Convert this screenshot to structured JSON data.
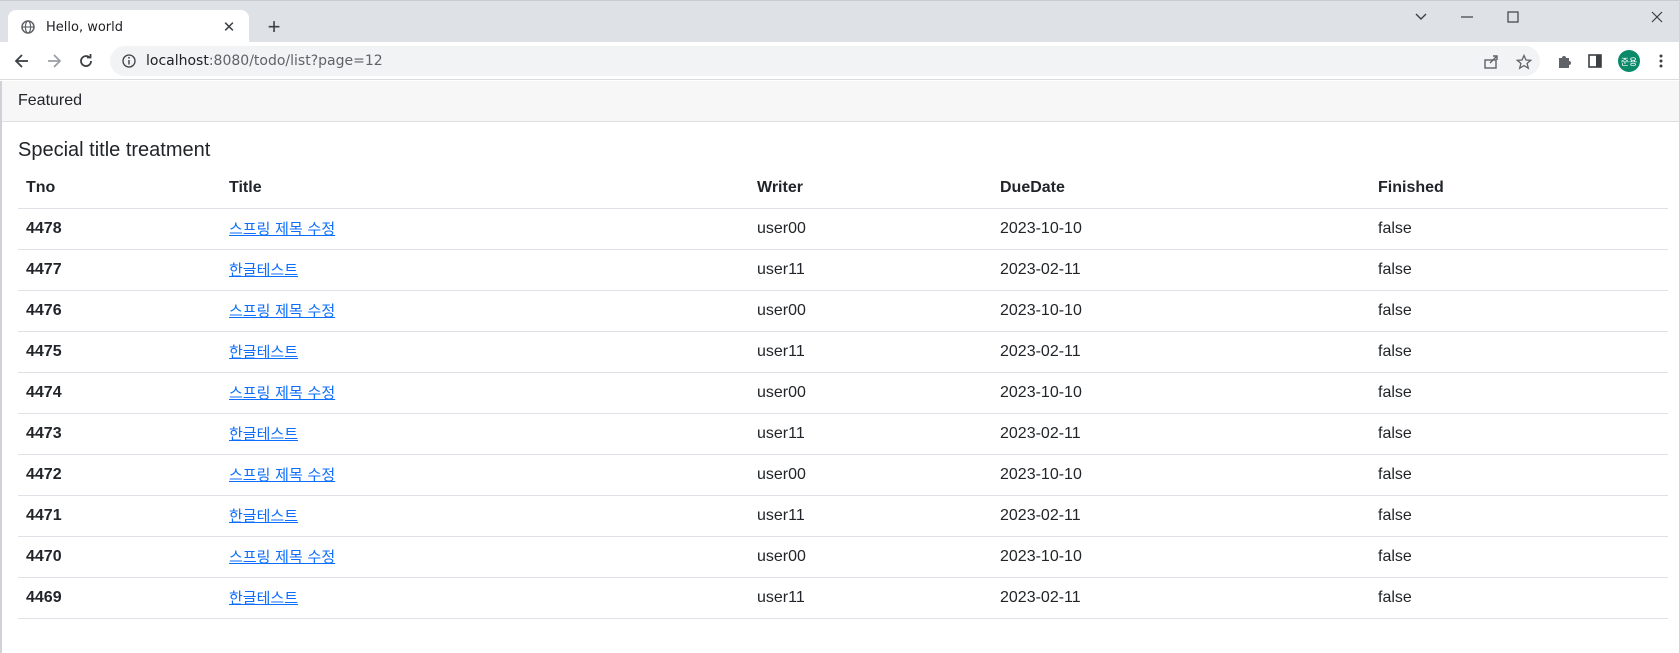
{
  "browser": {
    "tab_title": "Hello, world",
    "url_host": "localhost",
    "url_path": ":8080/todo/list?page=12",
    "avatar_text": "준용"
  },
  "card": {
    "header": "Featured",
    "title": "Special title treatment"
  },
  "table": {
    "columns": [
      "Tno",
      "Title",
      "Writer",
      "DueDate",
      "Finished"
    ],
    "rows": [
      {
        "tno": "4478",
        "title": "스프링 제목 수정",
        "writer": "user00",
        "due": "2023-10-10",
        "finished": "false"
      },
      {
        "tno": "4477",
        "title": "한글테스트",
        "writer": "user11",
        "due": "2023-02-11",
        "finished": "false"
      },
      {
        "tno": "4476",
        "title": "스프링 제목 수정",
        "writer": "user00",
        "due": "2023-10-10",
        "finished": "false"
      },
      {
        "tno": "4475",
        "title": "한글테스트",
        "writer": "user11",
        "due": "2023-02-11",
        "finished": "false"
      },
      {
        "tno": "4474",
        "title": "스프링 제목 수정",
        "writer": "user00",
        "due": "2023-10-10",
        "finished": "false"
      },
      {
        "tno": "4473",
        "title": "한글테스트",
        "writer": "user11",
        "due": "2023-02-11",
        "finished": "false"
      },
      {
        "tno": "4472",
        "title": "스프링 제목 수정",
        "writer": "user00",
        "due": "2023-10-10",
        "finished": "false"
      },
      {
        "tno": "4471",
        "title": "한글테스트",
        "writer": "user11",
        "due": "2023-02-11",
        "finished": "false"
      },
      {
        "tno": "4470",
        "title": "스프링 제목 수정",
        "writer": "user00",
        "due": "2023-10-10",
        "finished": "false"
      },
      {
        "tno": "4469",
        "title": "한글테스트",
        "writer": "user11",
        "due": "2023-02-11",
        "finished": "false"
      }
    ]
  },
  "colors": {
    "link": "#0d6efd",
    "card_header_bg": "#f7f7f7",
    "avatar_bg": "#0b8a6a"
  },
  "icons": [
    "globe-icon",
    "close-icon",
    "plus-icon",
    "chevron-down-icon",
    "minimize-icon",
    "maximize-icon",
    "window-close-icon",
    "back-arrow-icon",
    "forward-arrow-icon",
    "reload-icon",
    "info-icon",
    "share-icon",
    "star-icon",
    "puzzle-icon",
    "side-panel-icon",
    "more-vert-icon"
  ]
}
